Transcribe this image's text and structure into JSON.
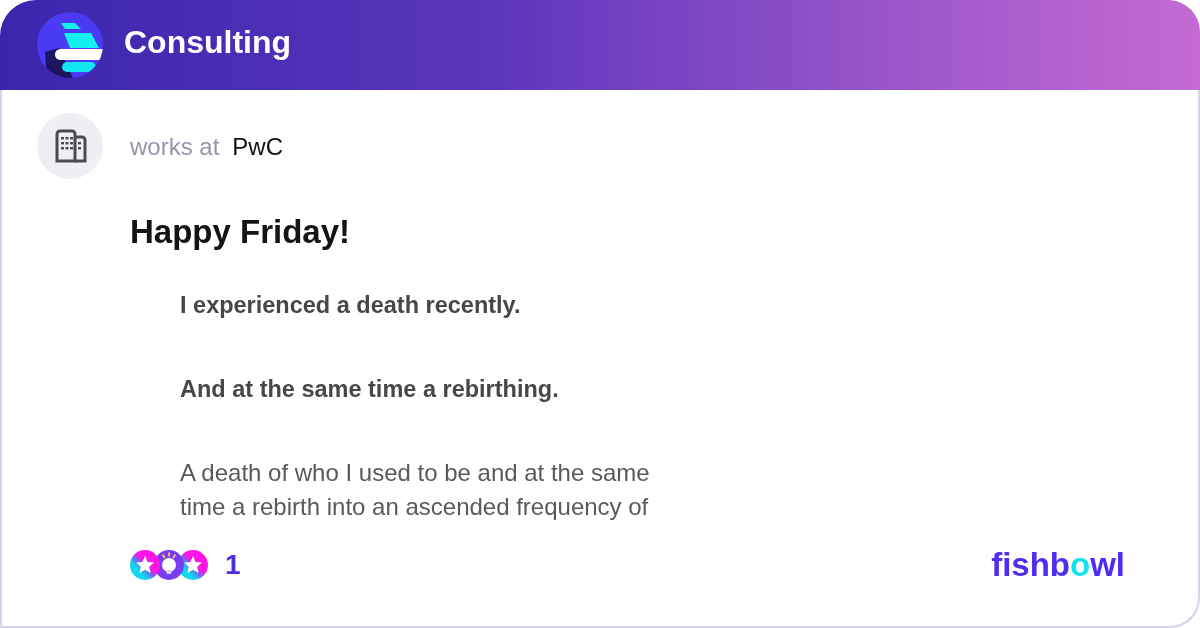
{
  "header": {
    "title": "Consulting"
  },
  "author": {
    "label": "works at",
    "company": "PwC"
  },
  "post": {
    "title": "Happy Friday!",
    "image_text": [
      {
        "bold": true,
        "lines": [
          "I experienced a death recently."
        ]
      },
      {
        "bold": true,
        "lines": [
          "And at the same time a rebirthing."
        ]
      },
      {
        "bold": false,
        "lines": [
          "A death of who I used to be and at the same",
          "time a rebirth into an ascended frequency of"
        ]
      }
    ]
  },
  "reactions": {
    "count": "1"
  },
  "brand": {
    "parts": [
      {
        "text": "fishb",
        "accent": false
      },
      {
        "text": "o",
        "accent": true
      },
      {
        "text": "wl",
        "accent": false
      }
    ]
  }
}
